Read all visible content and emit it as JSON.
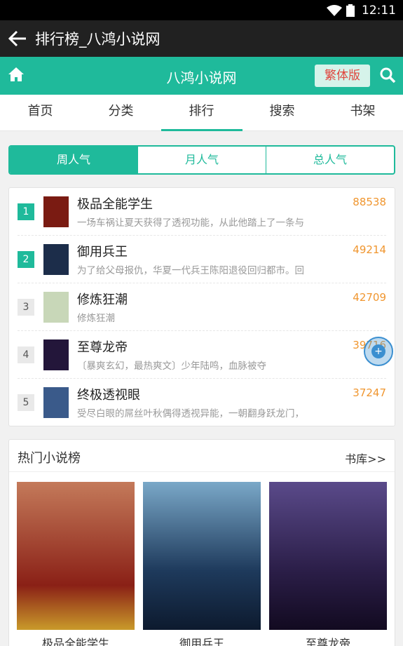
{
  "status": {
    "time": "12:11"
  },
  "titlebar": {
    "title": "排行榜_八鸿小说网"
  },
  "appbar": {
    "brand": "八鸿小说网",
    "trad_label": "繁体版"
  },
  "tabs": [
    {
      "label": "首页"
    },
    {
      "label": "分类"
    },
    {
      "label": "排行",
      "active": true
    },
    {
      "label": "搜索"
    },
    {
      "label": "书架"
    }
  ],
  "period": [
    {
      "label": "周人气",
      "active": true
    },
    {
      "label": "月人气"
    },
    {
      "label": "总人气"
    }
  ],
  "ranking": [
    {
      "rank": "1",
      "name": "极品全能学生",
      "desc": "一场车祸让夏天获得了透视功能，从此他踏上了一条与",
      "score": "88538",
      "cover": "#7a1b12"
    },
    {
      "rank": "2",
      "name": "御用兵王",
      "desc": "为了给父母报仇，华夏一代兵王陈阳退役回归都市。回",
      "score": "49214",
      "cover": "#1c2d4a"
    },
    {
      "rank": "3",
      "name": "修炼狂潮",
      "desc": "修炼狂潮",
      "score": "42709",
      "cover": "#c8d7b8"
    },
    {
      "rank": "4",
      "name": "至尊龙帝",
      "desc": "〔暴爽玄幻，最热爽文〕少年陆鸣，血脉被夺",
      "score": "39716",
      "cover": "#23163a"
    },
    {
      "rank": "5",
      "name": "终极透视眼",
      "desc": "受尽白眼的屌丝叶秋偶得透视异能，一朝翻身跃龙门，",
      "score": "37247",
      "cover": "#3a5a8a"
    }
  ],
  "hot": {
    "title": "热门小说榜",
    "more": "书库>>",
    "books": [
      {
        "name": "极品全能学生",
        "cover": "#8a2016"
      },
      {
        "name": "御用兵王",
        "cover": "#1e3a5c"
      },
      {
        "name": "至尊龙帝",
        "cover": "#2b1e48"
      }
    ]
  },
  "colors": {
    "accent": "#1fba9b",
    "score": "#f0962f",
    "trad_text": "#e0463e"
  }
}
